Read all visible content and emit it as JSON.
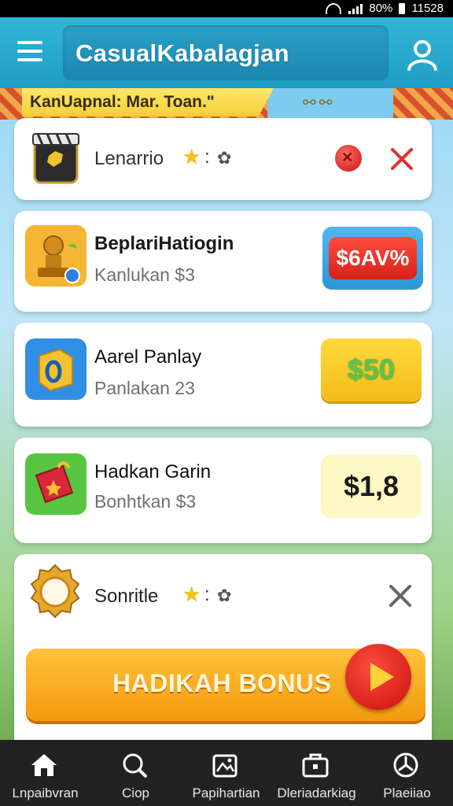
{
  "status_bar": {
    "battery": "80%",
    "time": "11528"
  },
  "header": {
    "title": "CasualKabalagjan"
  },
  "banner": {
    "text": "KanUapnal: Mar. Toan.\""
  },
  "cards": [
    {
      "name": "Lenarrio",
      "star_sep": ":",
      "icon": "clapperboard-icon"
    },
    {
      "name": "BeplariHatiogin",
      "sub": "Kanlukan $3",
      "price": "$6AV%",
      "icon": "trophy-icon"
    },
    {
      "name": "Aarel Panlay",
      "sub": "Panlakan 23",
      "price": "$50",
      "icon": "ring-box-icon"
    },
    {
      "name": "Hadkan Garin",
      "sub": "Bonhtkan $3",
      "price": "$1,8",
      "icon": "gift-bag-icon"
    },
    {
      "name": "Sonritle",
      "star_sep": ":",
      "icon": "golden-mirror-icon"
    }
  ],
  "bonus_button": {
    "label": "HADIKAH BONUS"
  },
  "bottom_nav": [
    {
      "label": "Lnpaibvran",
      "icon": "home-icon"
    },
    {
      "label": "Ciop",
      "icon": "search-icon"
    },
    {
      "label": "Papihartian",
      "icon": "gallery-icon"
    },
    {
      "label": "Dleriadarkiag",
      "icon": "briefcase-icon"
    },
    {
      "label": "Plaeiiao",
      "icon": "clock-icon"
    }
  ],
  "colors": {
    "header": "#1e9dc4",
    "accent_orange": "#f39a0e",
    "red": "#e0322c",
    "nav_bg": "#222222"
  }
}
